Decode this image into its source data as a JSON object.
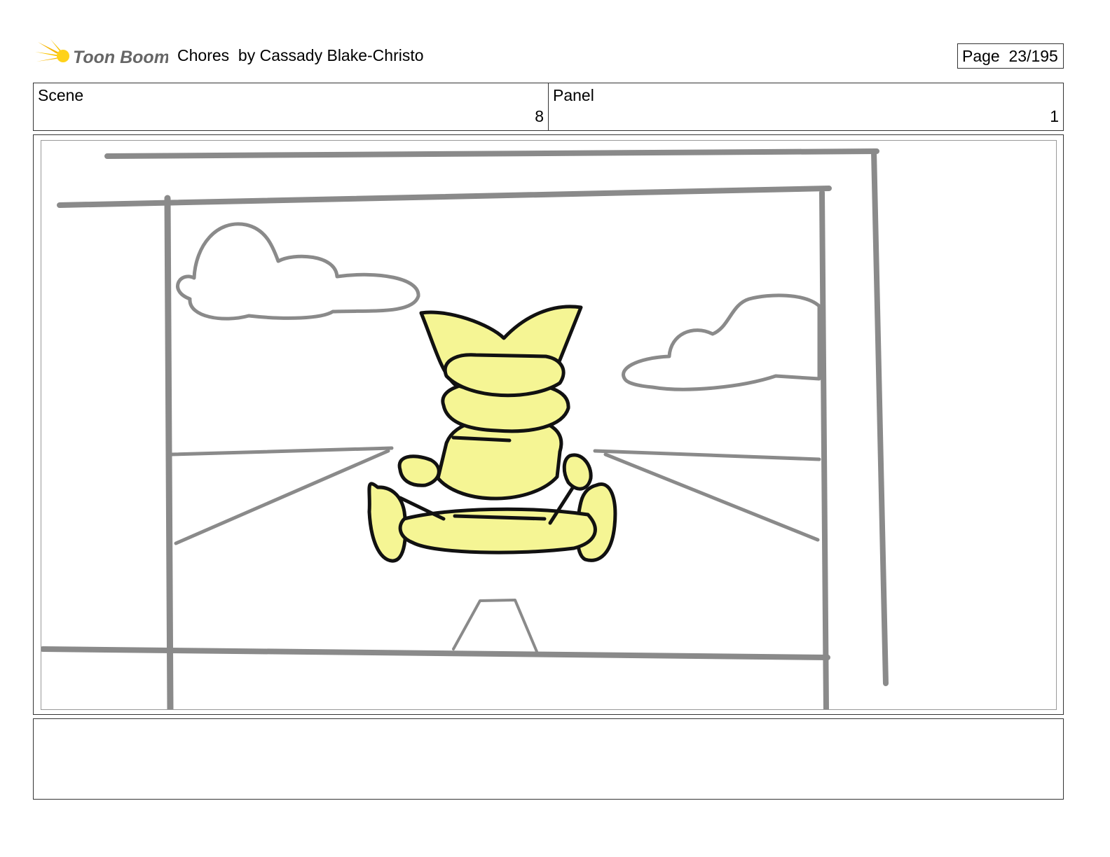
{
  "header": {
    "logo_text": "Toon Boom",
    "title": "Chores  by Cassady Blake-Christo",
    "page_label": "Page",
    "page_value": "23/195"
  },
  "info": {
    "scene_label": "Scene",
    "scene_value": "8",
    "panel_label": "Panel",
    "panel_value": "1"
  },
  "panel": {
    "description": "",
    "colors": {
      "frame_lines": "#8a8a8a",
      "character_fill": "#f5f594",
      "ink": "#111111"
    }
  },
  "notes": {
    "text": ""
  }
}
